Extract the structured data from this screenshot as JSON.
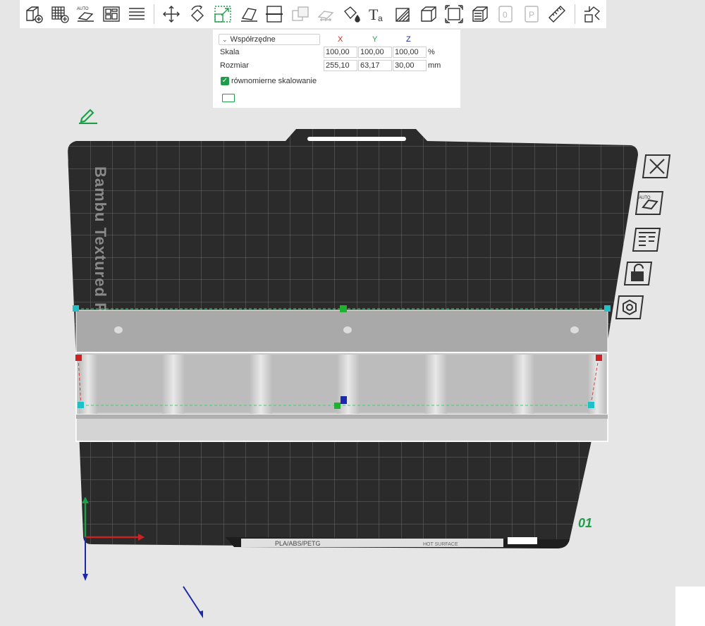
{
  "toolbar": {
    "items": [
      {
        "name": "add-object-icon"
      },
      {
        "name": "add-plate-icon"
      },
      {
        "name": "auto-orient-icon",
        "label": "AUTO"
      },
      {
        "name": "arrange-icon"
      },
      {
        "name": "split-layers-icon"
      },
      {
        "name": "move-icon"
      },
      {
        "name": "rotate-icon"
      },
      {
        "name": "scale-icon",
        "active": true
      },
      {
        "name": "lay-on-face-icon"
      },
      {
        "name": "cut-icon"
      },
      {
        "name": "boolean-icon",
        "disabled": true
      },
      {
        "name": "support-paint-icon",
        "disabled": true
      },
      {
        "name": "color-paint-icon"
      },
      {
        "name": "text-icon"
      },
      {
        "name": "seam-paint-icon"
      },
      {
        "name": "mesh-box-icon"
      },
      {
        "name": "fit-to-bed-icon"
      },
      {
        "name": "layers-view-icon"
      },
      {
        "name": "object-list-icon",
        "disabled": true
      },
      {
        "name": "plate-settings-icon",
        "disabled": true
      },
      {
        "name": "measure-icon"
      },
      {
        "name": "assembly-icon"
      }
    ]
  },
  "scale_panel": {
    "coord_dropdown": "Współrzędne",
    "axes": {
      "x": "X",
      "y": "Y",
      "z": "Z"
    },
    "scale_label": "Skala",
    "scale": {
      "x": "100,00",
      "y": "100,00",
      "z": "100,00"
    },
    "scale_unit": "%",
    "size_label": "Rozmiar",
    "size": {
      "x": "255,10",
      "y": "63,17",
      "z": "30,00"
    },
    "size_unit": "mm",
    "uniform_label": "równomierne skalowanie",
    "uniform_checked": true
  },
  "plate": {
    "brand_text": "Bambu Textured P",
    "bottom_label": "PLA/ABS/PETG",
    "hot_surface_label": "HOT SURFACE",
    "plate_number": "01"
  },
  "colors": {
    "accent_green": "#1f9e4a",
    "axis_x": "#cc2222",
    "axis_y": "#1f9e4a",
    "axis_z": "#1a2aa8",
    "plate": "#2b2b2b",
    "model": "#cfcfcf"
  }
}
